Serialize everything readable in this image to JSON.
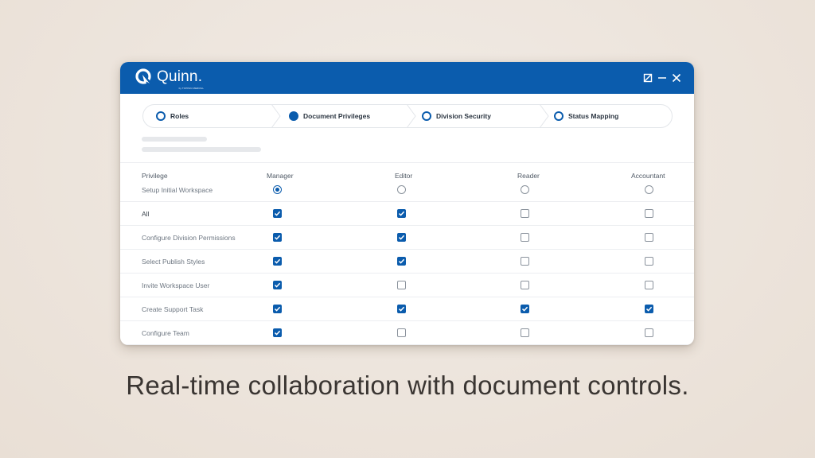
{
  "app": {
    "name": "Quinn.",
    "sub": "by TOPPAN MERRILL",
    "brand_color": "#0b5cad"
  },
  "window_controls": [
    "resize-icon",
    "minimize-icon",
    "close-icon"
  ],
  "steps": [
    {
      "label": "Roles",
      "state": "incomplete"
    },
    {
      "label": "Document Privileges",
      "state": "active"
    },
    {
      "label": "Division Security",
      "state": "incomplete"
    },
    {
      "label": "Status Mapping",
      "state": "incomplete"
    }
  ],
  "table": {
    "headers": [
      "Privilege",
      "Manager",
      "Editor",
      "Reader",
      "Accountant"
    ],
    "radio_row": {
      "label": "Setup Initial Workspace",
      "selected": [
        true,
        false,
        false,
        false
      ]
    },
    "rows": [
      {
        "label": "All",
        "checked": [
          true,
          true,
          false,
          false
        ]
      },
      {
        "label": "Configure Division Permissions",
        "checked": [
          true,
          true,
          false,
          false
        ]
      },
      {
        "label": "Select Publish Styles",
        "checked": [
          true,
          true,
          false,
          false
        ]
      },
      {
        "label": "Invite Workspace User",
        "checked": [
          true,
          false,
          false,
          false
        ]
      },
      {
        "label": "Create Support Task",
        "checked": [
          true,
          true,
          true,
          true
        ]
      },
      {
        "label": "Configure Team",
        "checked": [
          true,
          false,
          false,
          false
        ]
      }
    ]
  },
  "caption": "Real-time collaboration with document controls."
}
